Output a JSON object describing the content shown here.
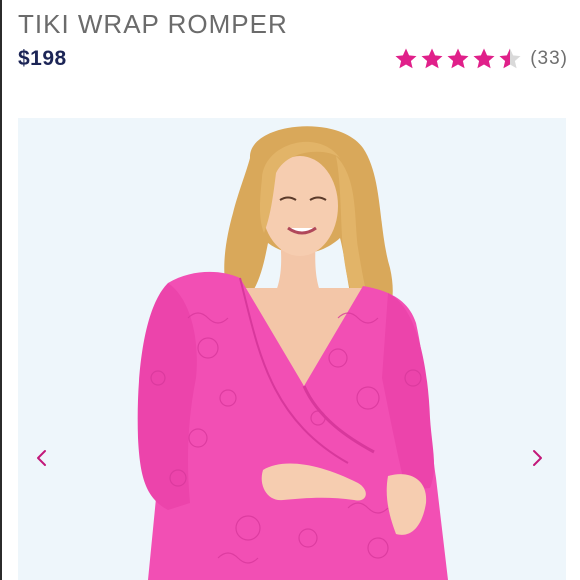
{
  "product": {
    "title": "TIKI WRAP ROMPER",
    "price": "$198"
  },
  "rating": {
    "value": 4.5,
    "max": 5,
    "count_label": "(33)",
    "star_color": "#e0208a"
  },
  "carousel": {
    "background": "#eef6fb",
    "prev_icon": "chevron-left-icon",
    "next_icon": "chevron-right-icon",
    "arrow_color": "#c2187a"
  },
  "colors": {
    "title": "#6b6b6b",
    "price": "#1c2556",
    "dress": "#f24fb4"
  }
}
